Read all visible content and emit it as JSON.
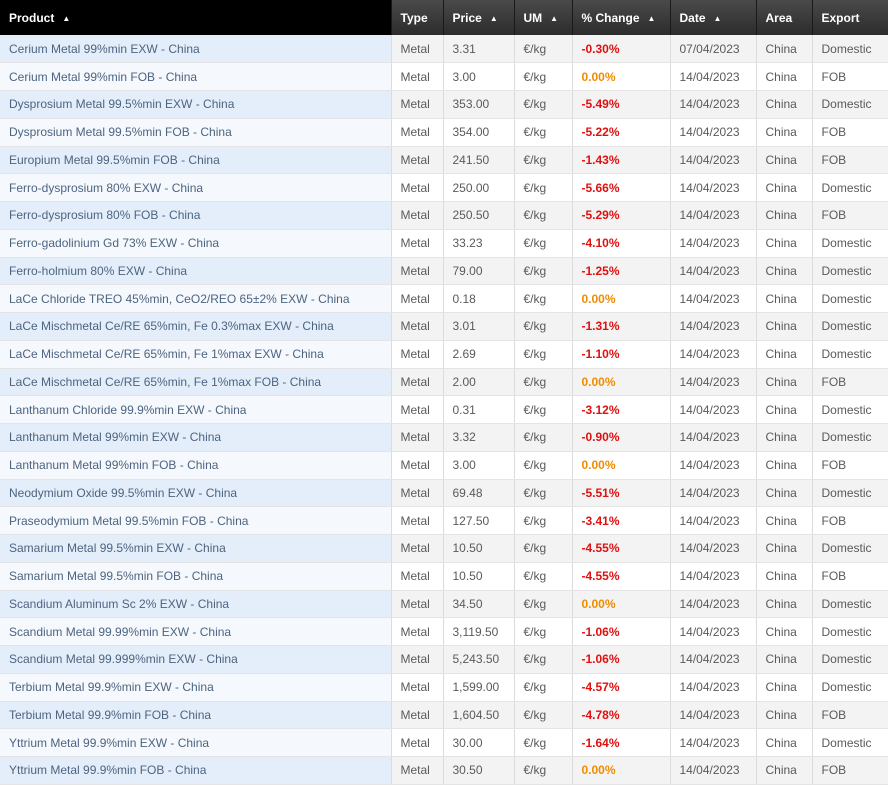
{
  "columns": [
    {
      "key": "product",
      "label": "Product",
      "sortable": true
    },
    {
      "key": "type",
      "label": "Type",
      "sortable": false
    },
    {
      "key": "price",
      "label": "Price",
      "sortable": true
    },
    {
      "key": "um",
      "label": "UM",
      "sortable": true
    },
    {
      "key": "change",
      "label": "% Change",
      "sortable": true
    },
    {
      "key": "date",
      "label": "Date",
      "sortable": true
    },
    {
      "key": "area",
      "label": "Area",
      "sortable": false
    },
    {
      "key": "export",
      "label": "Export",
      "sortable": false
    }
  ],
  "sort_icon": "▲",
  "colors": {
    "negative": "#e01010",
    "zero": "#f08c00",
    "header_bg": "#2c2c2c",
    "product_text": "#4d6480"
  },
  "rows": [
    {
      "product": "Cerium Metal 99%min EXW - China",
      "type": "Metal",
      "price": "3.31",
      "um": "€/kg",
      "change": "-0.30%",
      "date": "07/04/2023",
      "area": "China",
      "export": "Domestic"
    },
    {
      "product": "Cerium Metal 99%min FOB - China",
      "type": "Metal",
      "price": "3.00",
      "um": "€/kg",
      "change": "0.00%",
      "date": "14/04/2023",
      "area": "China",
      "export": "FOB"
    },
    {
      "product": "Dysprosium Metal 99.5%min EXW - China",
      "type": "Metal",
      "price": "353.00",
      "um": "€/kg",
      "change": "-5.49%",
      "date": "14/04/2023",
      "area": "China",
      "export": "Domestic"
    },
    {
      "product": "Dysprosium Metal 99.5%min FOB - China",
      "type": "Metal",
      "price": "354.00",
      "um": "€/kg",
      "change": "-5.22%",
      "date": "14/04/2023",
      "area": "China",
      "export": "FOB"
    },
    {
      "product": "Europium Metal 99.5%min FOB - China",
      "type": "Metal",
      "price": "241.50",
      "um": "€/kg",
      "change": "-1.43%",
      "date": "14/04/2023",
      "area": "China",
      "export": "FOB"
    },
    {
      "product": "Ferro-dysprosium 80% EXW - China",
      "type": "Metal",
      "price": "250.00",
      "um": "€/kg",
      "change": "-5.66%",
      "date": "14/04/2023",
      "area": "China",
      "export": "Domestic"
    },
    {
      "product": "Ferro-dysprosium 80% FOB - China",
      "type": "Metal",
      "price": "250.50",
      "um": "€/kg",
      "change": "-5.29%",
      "date": "14/04/2023",
      "area": "China",
      "export": "FOB"
    },
    {
      "product": "Ferro-gadolinium Gd 73% EXW - China",
      "type": "Metal",
      "price": "33.23",
      "um": "€/kg",
      "change": "-4.10%",
      "date": "14/04/2023",
      "area": "China",
      "export": "Domestic"
    },
    {
      "product": "Ferro-holmium 80% EXW - China",
      "type": "Metal",
      "price": "79.00",
      "um": "€/kg",
      "change": "-1.25%",
      "date": "14/04/2023",
      "area": "China",
      "export": "Domestic"
    },
    {
      "product": "LaCe Chloride TREO 45%min, CeO2/REO 65±2% EXW - China",
      "type": "Metal",
      "price": "0.18",
      "um": "€/kg",
      "change": "0.00%",
      "date": "14/04/2023",
      "area": "China",
      "export": "Domestic"
    },
    {
      "product": "LaCe Mischmetal Ce/RE 65%min, Fe 0.3%max EXW - China",
      "type": "Metal",
      "price": "3.01",
      "um": "€/kg",
      "change": "-1.31%",
      "date": "14/04/2023",
      "area": "China",
      "export": "Domestic"
    },
    {
      "product": "LaCe Mischmetal Ce/RE 65%min, Fe 1%max EXW - China",
      "type": "Metal",
      "price": "2.69",
      "um": "€/kg",
      "change": "-1.10%",
      "date": "14/04/2023",
      "area": "China",
      "export": "Domestic"
    },
    {
      "product": "LaCe Mischmetal Ce/RE 65%min, Fe 1%max FOB - China",
      "type": "Metal",
      "price": "2.00",
      "um": "€/kg",
      "change": "0.00%",
      "date": "14/04/2023",
      "area": "China",
      "export": "FOB"
    },
    {
      "product": "Lanthanum Chloride 99.9%min EXW - China",
      "type": "Metal",
      "price": "0.31",
      "um": "€/kg",
      "change": "-3.12%",
      "date": "14/04/2023",
      "area": "China",
      "export": "Domestic"
    },
    {
      "product": "Lanthanum Metal 99%min EXW - China",
      "type": "Metal",
      "price": "3.32",
      "um": "€/kg",
      "change": "-0.90%",
      "date": "14/04/2023",
      "area": "China",
      "export": "Domestic"
    },
    {
      "product": "Lanthanum Metal 99%min FOB - China",
      "type": "Metal",
      "price": "3.00",
      "um": "€/kg",
      "change": "0.00%",
      "date": "14/04/2023",
      "area": "China",
      "export": "FOB"
    },
    {
      "product": "Neodymium Oxide 99.5%min EXW - China",
      "type": "Metal",
      "price": "69.48",
      "um": "€/kg",
      "change": "-5.51%",
      "date": "14/04/2023",
      "area": "China",
      "export": "Domestic"
    },
    {
      "product": "Praseodymium Metal 99.5%min FOB - China",
      "type": "Metal",
      "price": "127.50",
      "um": "€/kg",
      "change": "-3.41%",
      "date": "14/04/2023",
      "area": "China",
      "export": "FOB"
    },
    {
      "product": "Samarium Metal 99.5%min EXW - China",
      "type": "Metal",
      "price": "10.50",
      "um": "€/kg",
      "change": "-4.55%",
      "date": "14/04/2023",
      "area": "China",
      "export": "Domestic"
    },
    {
      "product": "Samarium Metal 99.5%min FOB - China",
      "type": "Metal",
      "price": "10.50",
      "um": "€/kg",
      "change": "-4.55%",
      "date": "14/04/2023",
      "area": "China",
      "export": "FOB"
    },
    {
      "product": "Scandium Aluminum Sc 2% EXW - China",
      "type": "Metal",
      "price": "34.50",
      "um": "€/kg",
      "change": "0.00%",
      "date": "14/04/2023",
      "area": "China",
      "export": "Domestic"
    },
    {
      "product": "Scandium Metal 99.99%min EXW - China",
      "type": "Metal",
      "price": "3,119.50",
      "um": "€/kg",
      "change": "-1.06%",
      "date": "14/04/2023",
      "area": "China",
      "export": "Domestic"
    },
    {
      "product": "Scandium Metal 99.999%min EXW - China",
      "type": "Metal",
      "price": "5,243.50",
      "um": "€/kg",
      "change": "-1.06%",
      "date": "14/04/2023",
      "area": "China",
      "export": "Domestic"
    },
    {
      "product": "Terbium Metal 99.9%min EXW - China",
      "type": "Metal",
      "price": "1,599.00",
      "um": "€/kg",
      "change": "-4.57%",
      "date": "14/04/2023",
      "area": "China",
      "export": "Domestic"
    },
    {
      "product": "Terbium Metal 99.9%min FOB - China",
      "type": "Metal",
      "price": "1,604.50",
      "um": "€/kg",
      "change": "-4.78%",
      "date": "14/04/2023",
      "area": "China",
      "export": "FOB"
    },
    {
      "product": "Yttrium Metal 99.9%min EXW - China",
      "type": "Metal",
      "price": "30.00",
      "um": "€/kg",
      "change": "-1.64%",
      "date": "14/04/2023",
      "area": "China",
      "export": "Domestic"
    },
    {
      "product": "Yttrium Metal 99.9%min FOB - China",
      "type": "Metal",
      "price": "30.50",
      "um": "€/kg",
      "change": "0.00%",
      "date": "14/04/2023",
      "area": "China",
      "export": "FOB"
    }
  ]
}
